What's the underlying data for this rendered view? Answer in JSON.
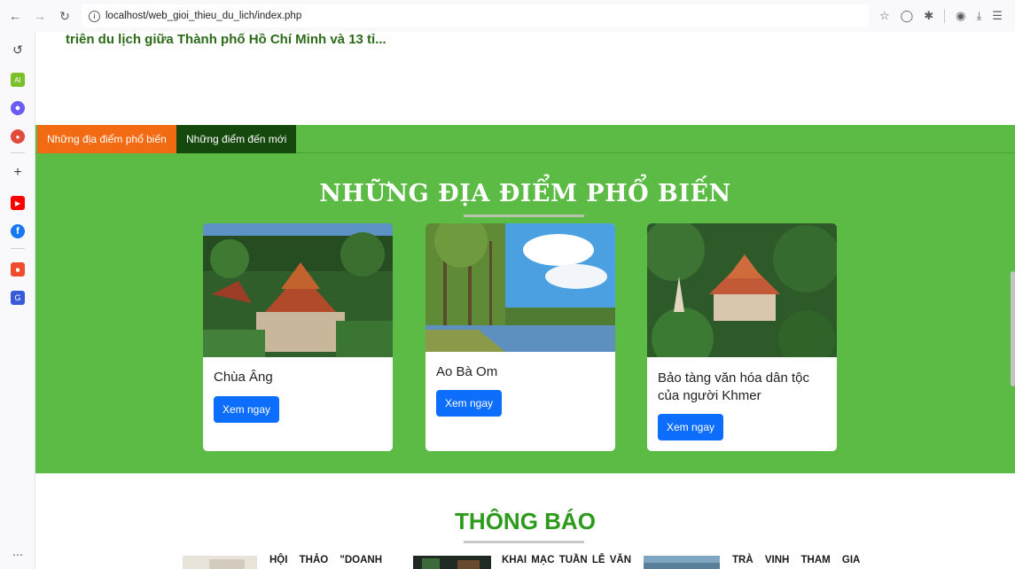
{
  "browser": {
    "url": "localhost/web_gioi_thieu_du_lich/index.php"
  },
  "page": {
    "top_text": "triên du lịch giữa Thành phố Hồ Chí Minh và 13 tỉ...",
    "tabs": [
      {
        "label": "Những địa điểm phổ biến"
      },
      {
        "label": "Những điểm đến mới"
      }
    ],
    "section_title": "NHỮNG ĐỊA ĐIỂM PHỔ BIẾN",
    "cards": [
      {
        "title": "Chùa Âng",
        "button": "Xem ngay"
      },
      {
        "title": "Ao Bà Om",
        "button": "Xem ngay"
      },
      {
        "title": "Bảo tàng văn hóa dân tộc của người Khmer",
        "button": "Xem ngay"
      }
    ],
    "notice_title": "THÔNG BÁO",
    "news": [
      {
        "title": "HỘI THẢO \"DOANH"
      },
      {
        "title": "KHAI MẠC TUẦN LỄ VĂN"
      },
      {
        "title": "TRÀ VINH THAM GIA"
      }
    ]
  },
  "colors": {
    "green_bg": "#5cbb45",
    "tab_active": "#f26b12",
    "tab_dark": "#15480d",
    "button": "#0d6efd",
    "notice": "#2c9a1a"
  }
}
